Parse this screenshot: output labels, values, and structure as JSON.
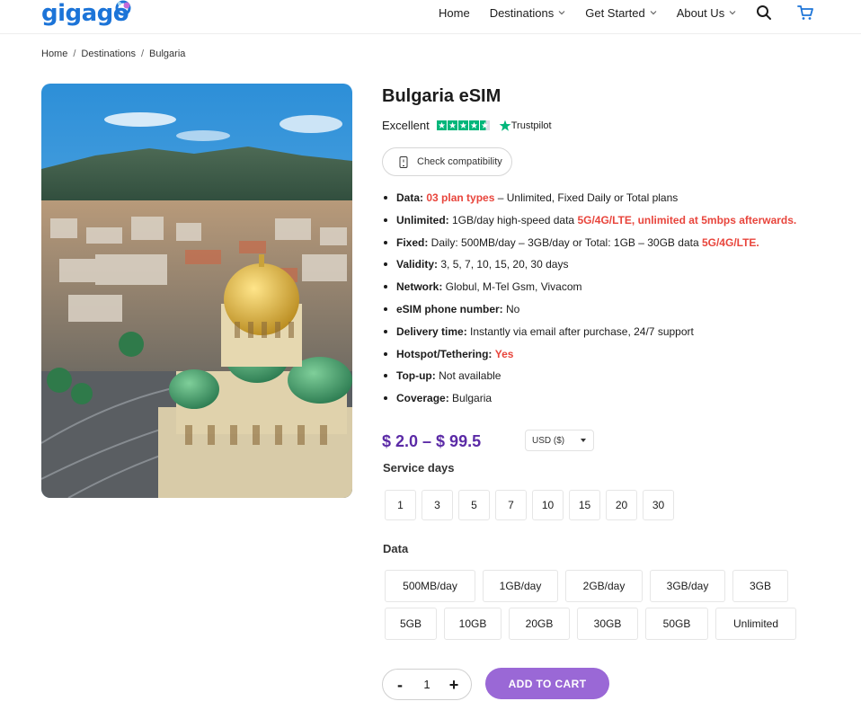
{
  "brand": {
    "name": "gigago",
    "color": "#1c74d8",
    "accent": "#5b2aa6"
  },
  "nav": {
    "items": [
      {
        "label": "Home",
        "dropdown": false
      },
      {
        "label": "Destinations",
        "dropdown": true
      },
      {
        "label": "Get Started",
        "dropdown": true
      },
      {
        "label": "About Us",
        "dropdown": true
      }
    ],
    "icons": [
      "search-icon",
      "cart-icon"
    ]
  },
  "breadcrumb": {
    "items": [
      "Home",
      "Destinations",
      "Bulgaria"
    ],
    "separator": "/"
  },
  "product": {
    "title": "Bulgaria eSIM",
    "rating_label": "Excellent",
    "rating_source": "Trustpilot",
    "rating_color": "#00b67a",
    "check_label": "Check compatibility",
    "features": [
      {
        "key": "Data:",
        "parts": [
          {
            "text": " "
          },
          {
            "text": "03 plan types",
            "red": true
          },
          {
            "text": " – Unlimited, Fixed Daily or Total plans"
          }
        ]
      },
      {
        "key": "Unlimited:",
        "parts": [
          {
            "text": " 1GB/day high-speed data "
          },
          {
            "text": "5G/4G/LTE, unlimited at 5mbps afterwards.",
            "red": true
          }
        ]
      },
      {
        "key": "Fixed:",
        "parts": [
          {
            "text": " Daily: 500MB/day – 3GB/day or Total: 1GB – 30GB data "
          },
          {
            "text": "5G/4G/LTE.",
            "red": true
          }
        ]
      },
      {
        "key": "Validity:",
        "parts": [
          {
            "text": " 3, 5, 7, 10, 15, 20, 30 days"
          }
        ]
      },
      {
        "key": "Network:",
        "parts": [
          {
            "text": " Globul, M-Tel Gsm, Vivacom"
          }
        ]
      },
      {
        "key": "eSIM phone number:",
        "parts": [
          {
            "text": " No"
          }
        ]
      },
      {
        "key": "Delivery time:",
        "parts": [
          {
            "text": " Instantly via email after purchase, 24/7 support"
          }
        ]
      },
      {
        "key": "Hotspot/Tethering:",
        "parts": [
          {
            "text": " "
          },
          {
            "text": "Yes",
            "red": true
          }
        ]
      },
      {
        "key": "Top-up:",
        "parts": [
          {
            "text": " Not available"
          }
        ]
      },
      {
        "key": "Coverage:",
        "parts": [
          {
            "text": " Bulgaria"
          }
        ]
      }
    ],
    "price": "$ 2.0 – $ 99.5",
    "currency": "USD ($)",
    "service_days_label": "Service days",
    "service_days": [
      "1",
      "3",
      "5",
      "7",
      "10",
      "15",
      "20",
      "30"
    ],
    "data_label": "Data",
    "data_row1": [
      "500MB/day",
      "1GB/day",
      "2GB/day",
      "3GB/day",
      "3GB"
    ],
    "data_row2": [
      "5GB",
      "10GB",
      "20GB",
      "30GB",
      "50GB",
      "Unlimited"
    ],
    "quantity": "1",
    "qty_minus": "-",
    "qty_plus": "+",
    "add_to_cart": "ADD TO CART"
  }
}
